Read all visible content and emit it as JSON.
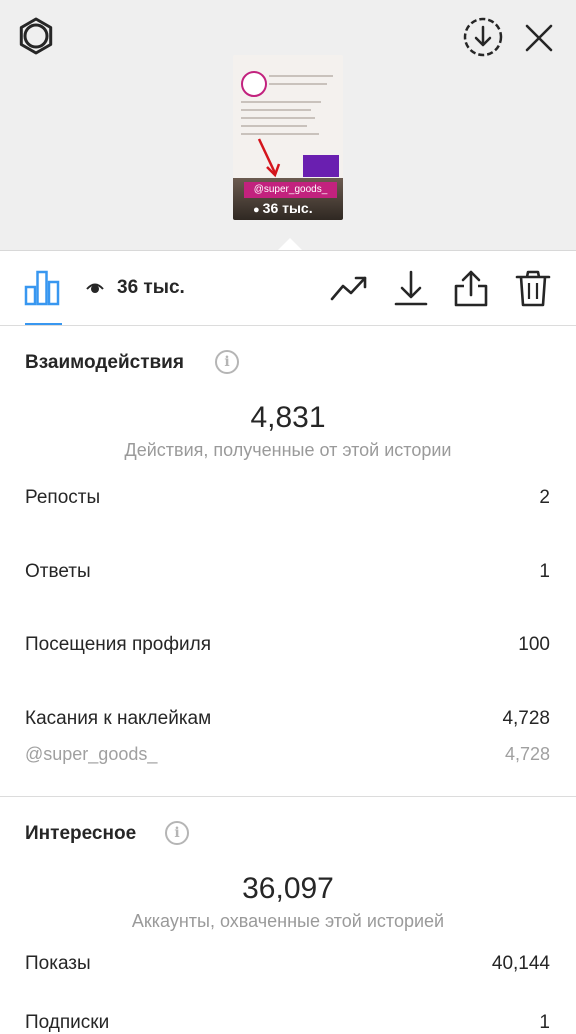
{
  "preview": {
    "sticker_text": "@super_goods_",
    "views_text": "36 тыс."
  },
  "toolbar": {
    "views_count": "36 тыс."
  },
  "interactions": {
    "title": "Взаимодействия",
    "total": "4,831",
    "total_caption": "Действия, полученные от этой истории",
    "rows": [
      {
        "label": "Репосты",
        "value": "2"
      },
      {
        "label": "Ответы",
        "value": "1"
      },
      {
        "label": "Посещения профиля",
        "value": "100"
      },
      {
        "label": "Касания к наклейкам",
        "value": "4,728"
      }
    ],
    "sticker_detail": {
      "label": "@super_goods_",
      "value": "4,728"
    }
  },
  "discovery": {
    "title": "Интересное",
    "total": "36,097",
    "total_caption": "Аккаунты, охваченные этой историей",
    "rows": [
      {
        "label": "Показы",
        "value": "40,144"
      },
      {
        "label": "Подписки",
        "value": "1"
      }
    ]
  },
  "colors": {
    "accent": "#3897f0",
    "sticker": "#c2227e",
    "text": "#262626",
    "muted": "#9a9a9a",
    "top_background": "#efefef"
  },
  "icons": [
    "settings-gear-icon",
    "download-circle-icon",
    "close-icon",
    "stats-bar-chart-icon",
    "eye-icon",
    "trend-icon",
    "download-icon",
    "share-icon",
    "trash-icon",
    "info-icon"
  ]
}
